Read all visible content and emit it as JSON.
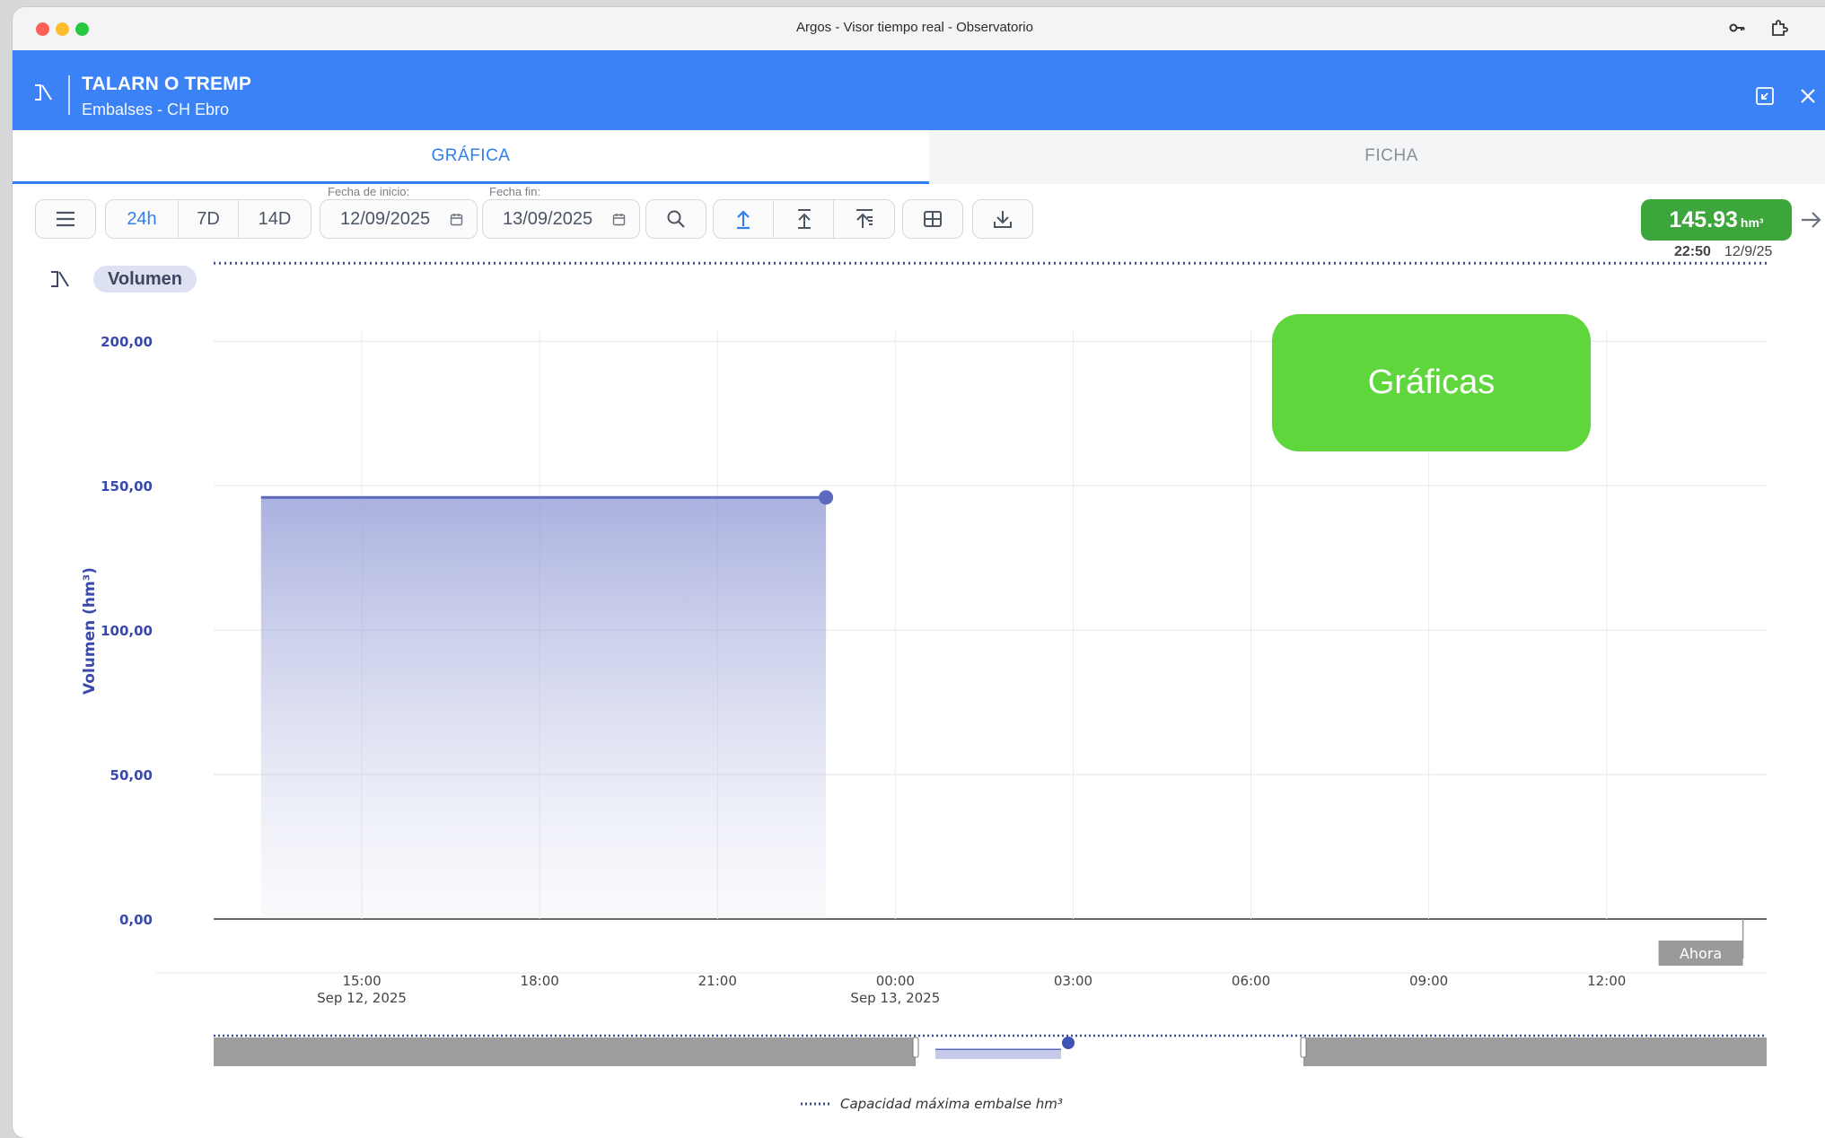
{
  "window": {
    "title": "Argos - Visor tiempo real - Observatorio"
  },
  "header": {
    "station_name": "TALARN O TREMP",
    "subtitle": "Embalses - CH Ebro",
    "bg_color": "#3b82f6"
  },
  "tabs": [
    {
      "label": "GRÁFICA",
      "active": true
    },
    {
      "label": "FICHA",
      "active": false
    }
  ],
  "toolbar": {
    "ranges": [
      "24h",
      "7D",
      "14D"
    ],
    "selected_range": "24h",
    "start_label": "Fecha de inicio:",
    "start_value": "12/09/2025",
    "end_label": "Fecha fin:",
    "end_value": "13/09/2025",
    "icons": [
      "menu-icon",
      "calendar-icon",
      "search-icon",
      "arrow-up-icon",
      "arrow-up-bar-icon",
      "arrow-up-lines-icon",
      "table-icon",
      "download-icon",
      "arrow-right-icon"
    ]
  },
  "current": {
    "value": "145.93",
    "unit": "hm³",
    "time": "22:50",
    "date": "12/9/25",
    "badge_color": "#3ca63c"
  },
  "series_chip": "Volumen",
  "overlay_badge": "Gráficas",
  "chart_data": {
    "type": "area",
    "ylabel": "Volumen (hm³)",
    "ylim": [
      0,
      210
    ],
    "yticks": [
      "0,00",
      "50,00",
      "100,00",
      "150,00",
      "200,00"
    ],
    "ytick_values": [
      0,
      50,
      100,
      150,
      200
    ],
    "xticks": [
      {
        "time": "15:00",
        "date": "Sep 12, 2025"
      },
      {
        "time": "18:00",
        "date": ""
      },
      {
        "time": "21:00",
        "date": ""
      },
      {
        "time": "00:00",
        "date": "Sep 13, 2025"
      },
      {
        "time": "03:00",
        "date": ""
      },
      {
        "time": "06:00",
        "date": ""
      },
      {
        "time": "09:00",
        "date": ""
      },
      {
        "time": "12:00",
        "date": ""
      }
    ],
    "xtick_hours": [
      15,
      18,
      21,
      24,
      27,
      30,
      33,
      36
    ],
    "x_range_hours": [
      12.5,
      38.7
    ],
    "series": [
      {
        "name": "Volumen",
        "color": "#5b6abf",
        "x_hours": [
          13.3,
          15.0,
          18.0,
          21.0,
          22.83
        ],
        "values": [
          145.93,
          145.93,
          145.93,
          145.93,
          145.93
        ]
      }
    ],
    "max_capacity": {
      "name": "Capacidad máxima embalse hm³",
      "value": 227,
      "style": "dotted"
    },
    "now_marker": {
      "label": "Ahora",
      "x_hours": 38.3
    },
    "grid": true,
    "legend": "bottom-center"
  }
}
